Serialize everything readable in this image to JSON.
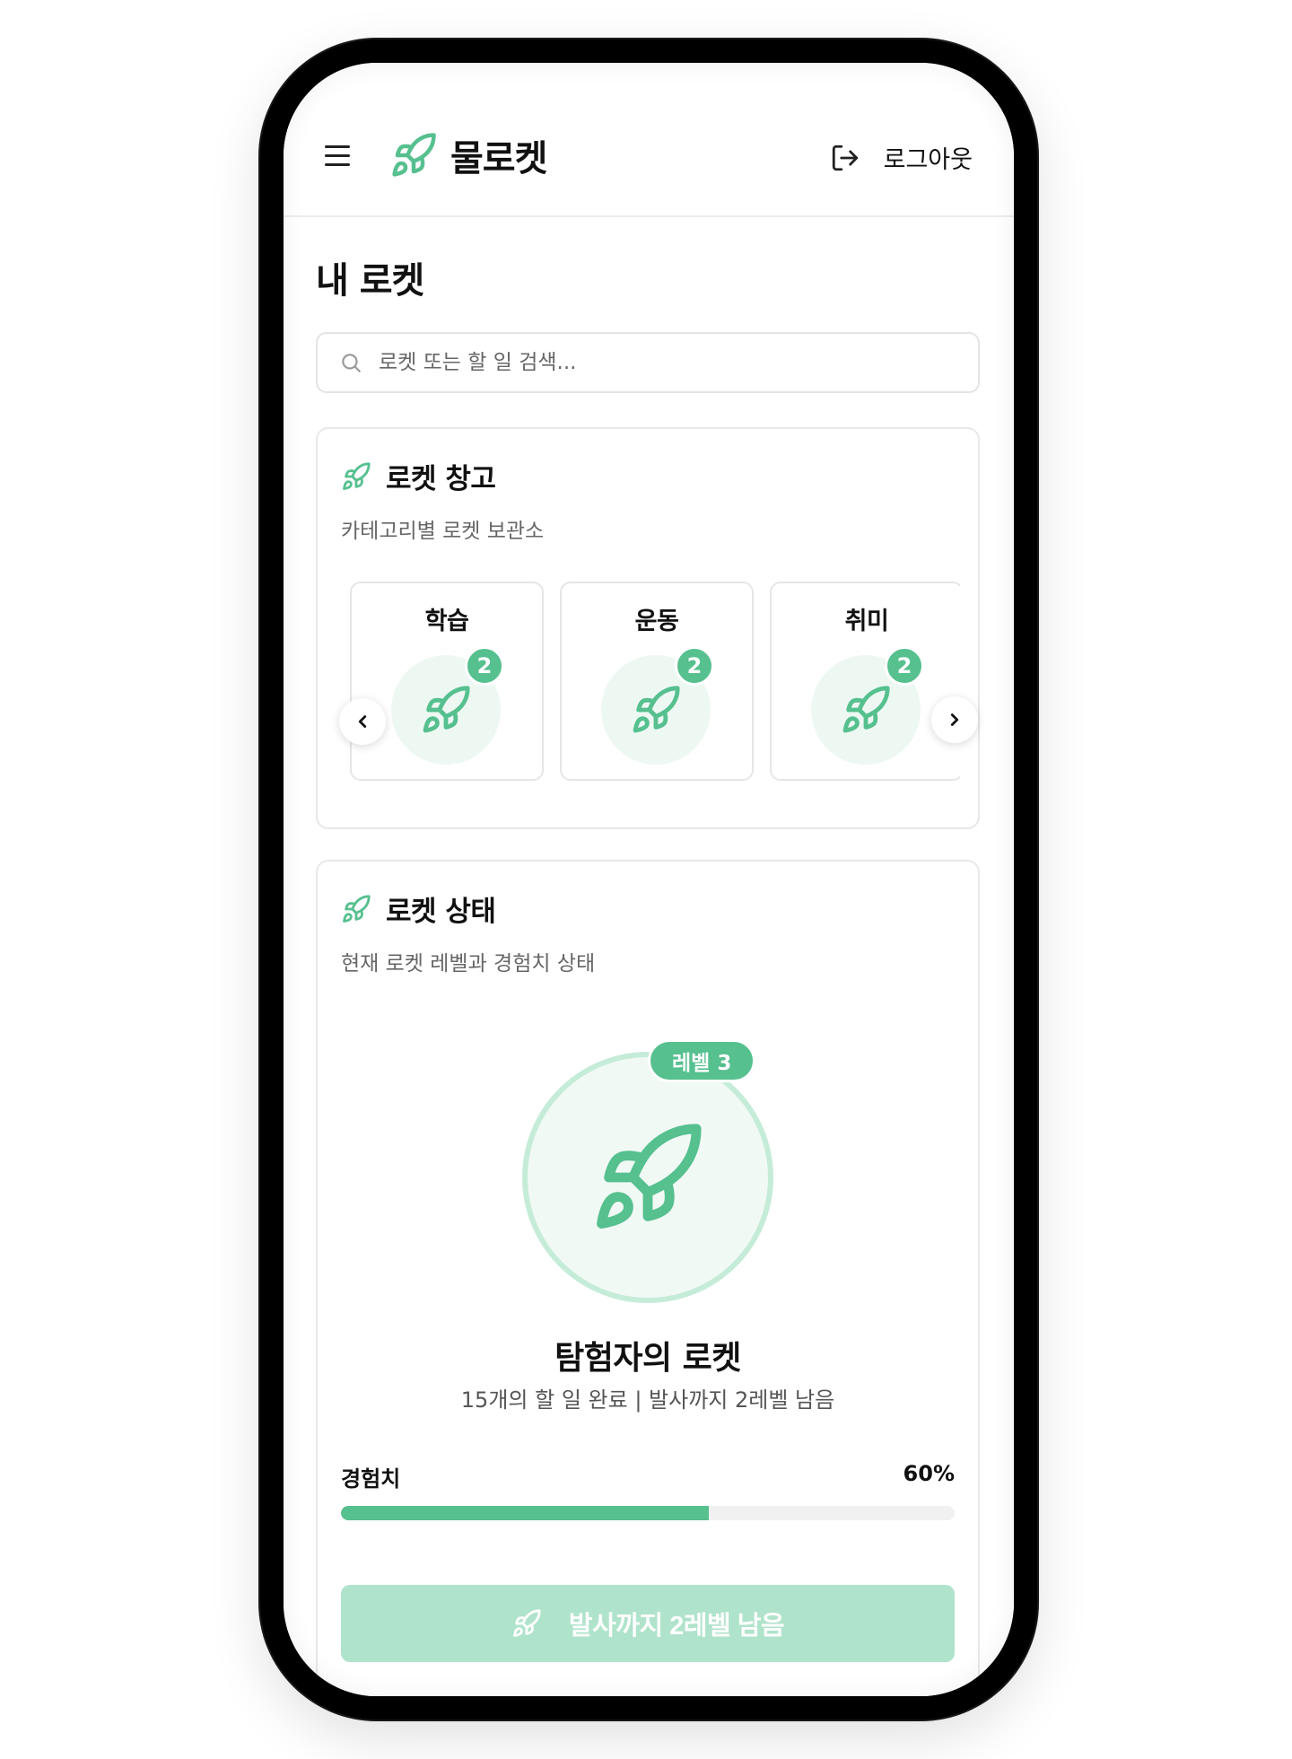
{
  "colors": {
    "accent": "#56c08f",
    "accent_soft": "#b0e3cb",
    "circle_bg": "#eef8f3"
  },
  "header": {
    "menu_icon": "hamburger-icon",
    "brand_icon": "rocket-icon",
    "title": "물로켓",
    "logout_icon": "logout-icon",
    "logout_label": "로그아웃"
  },
  "page": {
    "title": "내 로켓"
  },
  "search": {
    "placeholder": "로켓 또는 할 일 검색...",
    "value": ""
  },
  "warehouse": {
    "title": "로켓 창고",
    "subtitle": "카테고리별 로켓 보관소",
    "categories": [
      {
        "label": "학습",
        "count": "2"
      },
      {
        "label": "운동",
        "count": "2"
      },
      {
        "label": "취미",
        "count": "2"
      }
    ]
  },
  "status": {
    "title": "로켓 상태",
    "subtitle": "현재 로켓 레벨과 경험치 상태",
    "level_badge": "레벨 3",
    "rocket_name": "탐험자의 로켓",
    "summary": "15개의 할 일 완료 | 발사까지 2레벨 남음",
    "exp_label": "경험치",
    "exp_value": "60%",
    "exp_fraction": 0.6,
    "launch_label": "발사까지 2레벨 남음"
  }
}
